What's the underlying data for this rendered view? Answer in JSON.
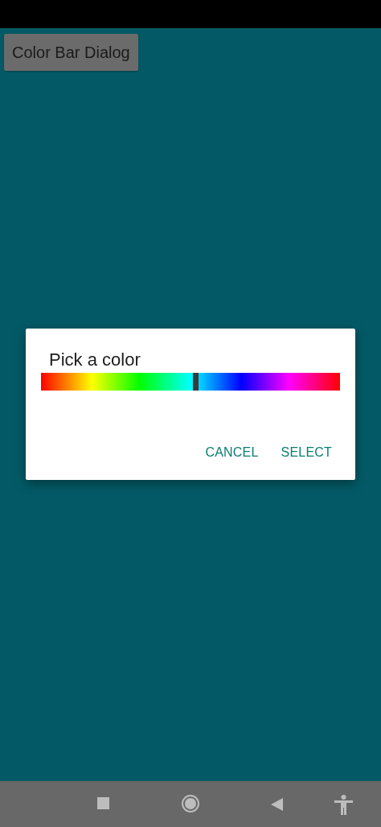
{
  "app_button": {
    "label": "Color Bar Dialog"
  },
  "dialog": {
    "title": "Pick a color",
    "color_bar": {
      "level": 0.516
    },
    "actions": [
      "CANCEL",
      "SELECT"
    ]
  }
}
